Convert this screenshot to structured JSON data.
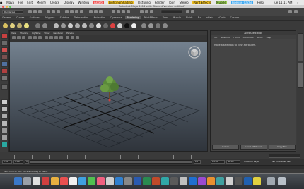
{
  "mac_menubar": {
    "items": [
      "Maya",
      "File",
      "Edit",
      "Modify",
      "Create",
      "Display",
      "Window",
      "Assets",
      "Lighting/Shading",
      "Texturing",
      "Render",
      "Toon",
      "Stereo",
      "Paint Effects",
      "Muscle",
      "Pipeline Cache",
      "Help"
    ],
    "clock": "Tue 11:11 AM"
  },
  "window_title": "Autodesk Maya 2014 x64 - Student Version: untitled*",
  "menu_set": "Rendering",
  "shelf_tabs": [
    "General",
    "Curves",
    "Surfaces",
    "Polygons",
    "Subdivs",
    "Deformation",
    "Animation",
    "Dynamics",
    "Rendering",
    "PaintEffects",
    "Toon",
    "Muscle",
    "Fluids",
    "Fur",
    "nHair",
    "nCloth",
    "Custom"
  ],
  "active_shelf_tab": "Rendering",
  "viewport_menu": [
    "View",
    "Shading",
    "Lighting",
    "Show",
    "Renderer",
    "Panels"
  ],
  "attribute_editor": {
    "title": "Attribute Editor",
    "menu": [
      "List",
      "Selected",
      "Focus",
      "Attributes",
      "Show",
      "Help"
    ],
    "message": "Make a selection to view attributes.",
    "buttons": [
      "Select",
      "Load Attributes",
      "Copy Tab"
    ]
  },
  "side_tabs": [
    "Channel Box / Layer Editor",
    "Attribute Editor"
  ],
  "range": {
    "start": "1.00",
    "start2": "1.00",
    "frame": "1",
    "end": "24",
    "end1": "24.00",
    "end2": "48.00",
    "anim_layer": "No Anim Layer",
    "char_set": "No Character Set"
  },
  "help_line": "Paint Effects Tool: Click and drag to paint.",
  "colors": {
    "viewport_top": "#7c8a98",
    "viewport_bottom": "#2f343b",
    "ui_bg": "#3c3c3c"
  }
}
